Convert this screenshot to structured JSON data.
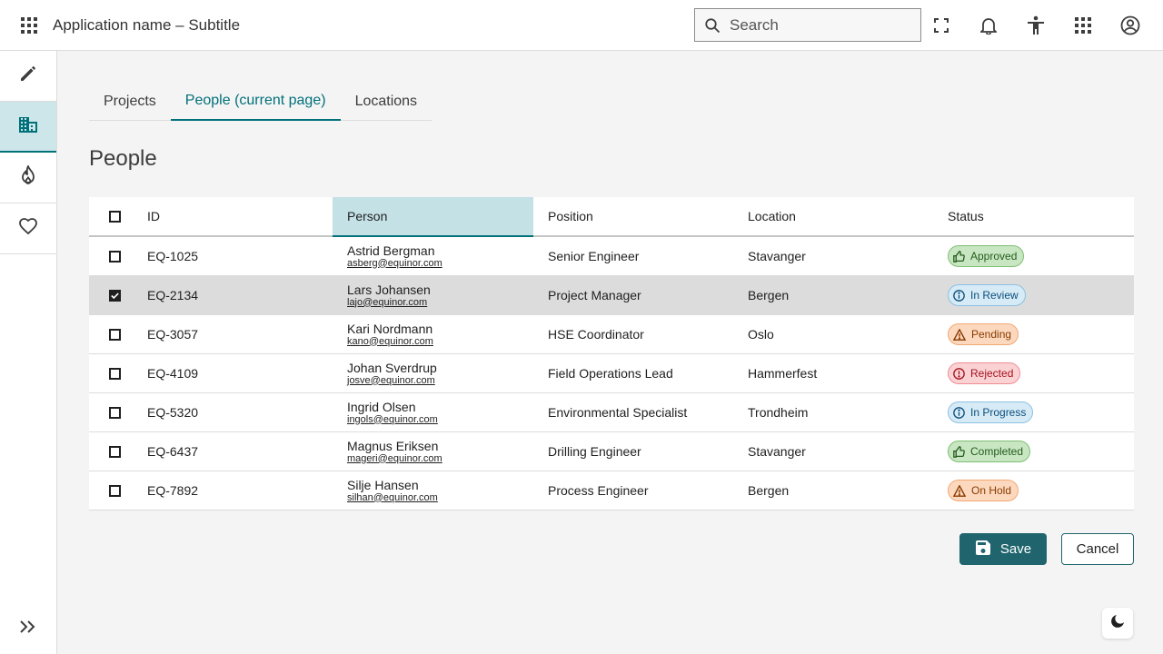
{
  "header": {
    "title": "Application name – Subtitle",
    "search_placeholder": "Search",
    "icons": [
      "apps-grid-icon",
      "fullscreen-icon",
      "notifications-icon",
      "accessibility-icon",
      "apps-icon",
      "account-icon"
    ]
  },
  "sidebar": {
    "items": [
      {
        "name": "edit",
        "icon": "pencil-icon",
        "active": false
      },
      {
        "name": "buildings",
        "icon": "building-icon",
        "active": true
      },
      {
        "name": "fire",
        "icon": "flame-icon",
        "active": false
      },
      {
        "name": "favorites",
        "icon": "heart-icon",
        "active": false
      }
    ],
    "expand_icon": "double-chevron-right-icon"
  },
  "tabs": [
    {
      "label": "Projects",
      "active": false
    },
    {
      "label": "People (current page)",
      "active": true
    },
    {
      "label": "Locations",
      "active": false
    }
  ],
  "page_title": "People",
  "table": {
    "columns": {
      "id": "ID",
      "person": "Person",
      "position": "Position",
      "location": "Location",
      "status": "Status"
    },
    "rows": [
      {
        "id": "EQ-1025",
        "name": "Astrid Bergman",
        "email": "asberg@equinor.com",
        "position": "Senior Engineer",
        "location": "Stavanger",
        "status": "Approved",
        "status_kind": "success",
        "checked": false
      },
      {
        "id": "EQ-2134",
        "name": "Lars Johansen",
        "email": "lajo@equinor.com",
        "position": "Project Manager",
        "location": "Bergen",
        "status": "In Review",
        "status_kind": "info",
        "checked": true
      },
      {
        "id": "EQ-3057",
        "name": "Kari Nordmann",
        "email": "kano@equinor.com",
        "position": "HSE Coordinator",
        "location": "Oslo",
        "status": "Pending",
        "status_kind": "warning",
        "checked": false
      },
      {
        "id": "EQ-4109",
        "name": "Johan Sverdrup",
        "email": "josve@equinor.com",
        "position": "Field Operations Lead",
        "location": "Hammerfest",
        "status": "Rejected",
        "status_kind": "danger",
        "checked": false
      },
      {
        "id": "EQ-5320",
        "name": "Ingrid Olsen",
        "email": "ingols@equinor.com",
        "position": "Environmental Specialist",
        "location": "Trondheim",
        "status": "In Progress",
        "status_kind": "info",
        "checked": false
      },
      {
        "id": "EQ-6437",
        "name": "Magnus Eriksen",
        "email": "mageri@equinor.com",
        "position": "Drilling Engineer",
        "location": "Stavanger",
        "status": "Completed",
        "status_kind": "success",
        "checked": false
      },
      {
        "id": "EQ-7892",
        "name": "Silje Hansen",
        "email": "silhan@equinor.com",
        "position": "Process Engineer",
        "location": "Bergen",
        "status": "On Hold",
        "status_kind": "warning",
        "checked": false
      }
    ]
  },
  "actions": {
    "save_label": "Save",
    "cancel_label": "Cancel"
  },
  "colors": {
    "accent": "#007079",
    "primary_button": "#20656d",
    "selected_row": "#dcdcdc",
    "sorted_header": "#c4e1e6"
  }
}
